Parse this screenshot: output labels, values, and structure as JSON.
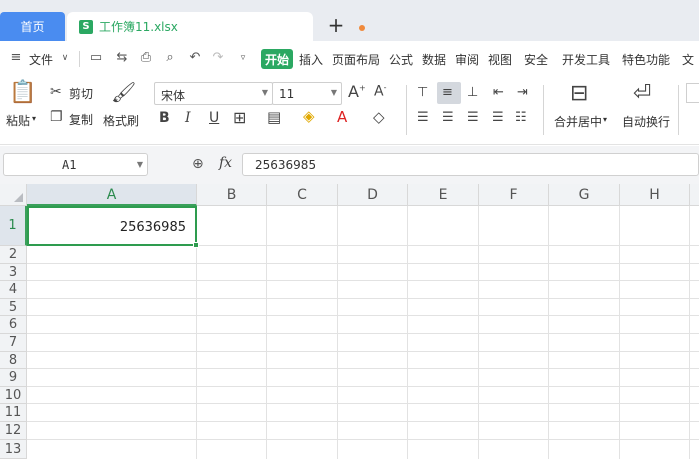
{
  "tabs": {
    "home": "首页",
    "document": "工作簿11.xlsx",
    "document_icon": "S"
  },
  "menu": {
    "file": "文件",
    "items": [
      "开始",
      "插入",
      "页面布局",
      "公式",
      "数据",
      "审阅",
      "视图",
      "安全",
      "开发工具",
      "特色功能",
      "文"
    ]
  },
  "ribbon": {
    "paste": "粘贴",
    "cut": "剪切",
    "copy": "复制",
    "format_painter": "格式刷",
    "font_name": "宋体",
    "font_size": "11",
    "bold": "B",
    "italic": "I",
    "underline": "U",
    "merge_center": "合并居中",
    "wrap_text": "自动换行"
  },
  "formula_bar": {
    "name_box": "A1",
    "fx": "fx",
    "value": "25636985"
  },
  "sheet": {
    "columns": [
      "A",
      "B",
      "C",
      "D",
      "E",
      "F",
      "G",
      "H"
    ],
    "rows": [
      "1",
      "2",
      "3",
      "4",
      "5",
      "6",
      "7",
      "8",
      "9",
      "10",
      "11",
      "12",
      "13"
    ],
    "active_cell": "A1",
    "cell_a1": "25636985"
  },
  "colors": {
    "accent_green": "#2ba862",
    "home_tab_blue": "#4a8cf0",
    "selection_green": "#2e9c4f"
  }
}
